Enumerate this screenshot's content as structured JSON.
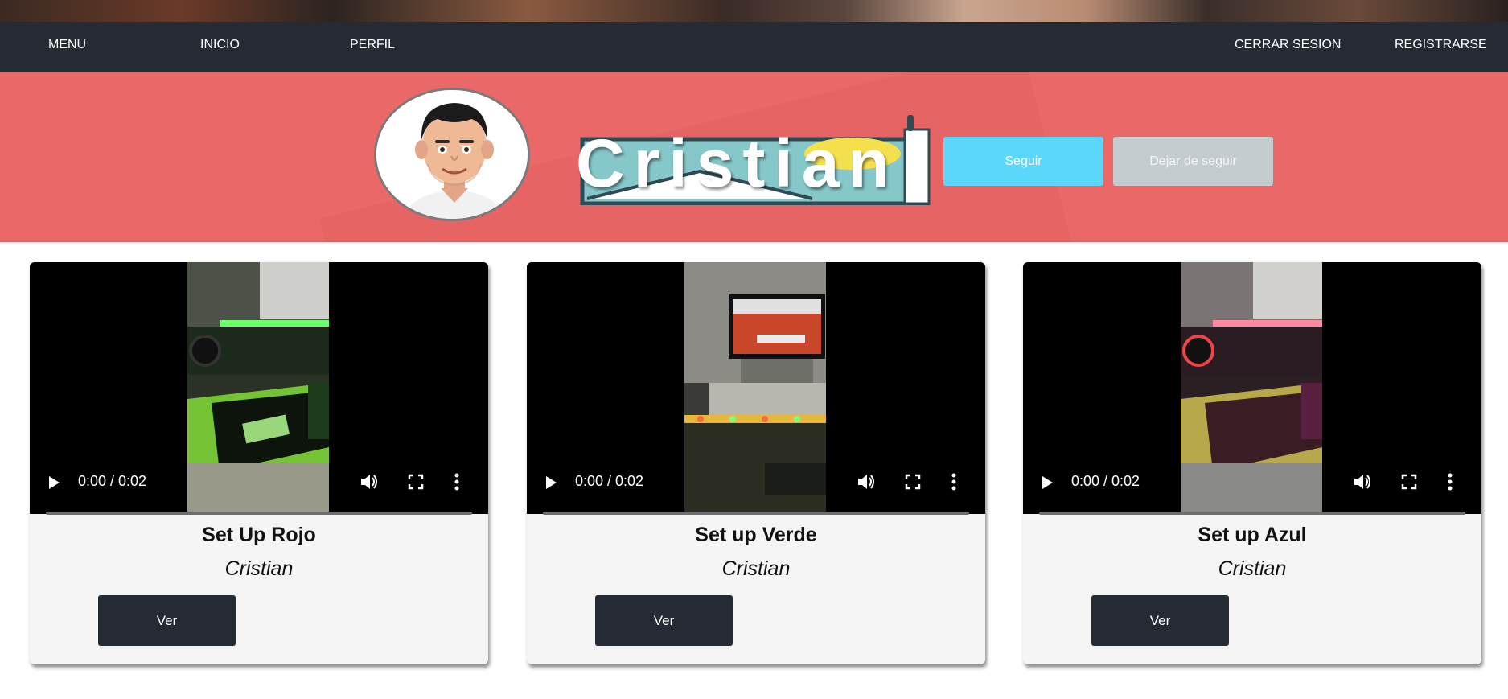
{
  "nav": {
    "menu": "MENU",
    "inicio": "INICIO",
    "perfil": "PERFIL",
    "cerrar_sesion": "CERRAR SESION",
    "registrarse": "REGISTRARSE"
  },
  "profile": {
    "name": "Cristian",
    "follow_label": "Seguir",
    "unfollow_label": "Dejar de seguir"
  },
  "videos": [
    {
      "title": "Set Up Rojo",
      "author": "Cristian",
      "time": "0:00 / 0:02",
      "button": "Ver",
      "thumb_icon": "green-setup-thumbnail"
    },
    {
      "title": "Set up Verde",
      "author": "Cristian",
      "time": "0:00 / 0:02",
      "button": "Ver",
      "thumb_icon": "monitor-setup-thumbnail"
    },
    {
      "title": "Set up Azul",
      "author": "Cristian",
      "time": "0:00 / 0:02",
      "button": "Ver",
      "thumb_icon": "pink-setup-thumbnail"
    }
  ],
  "colors": {
    "navbar": "#262a33",
    "banner": "#ea6968",
    "follow": "#5ad7fb",
    "unfollow": "#c5cccf",
    "card": "#f5f5f5"
  }
}
